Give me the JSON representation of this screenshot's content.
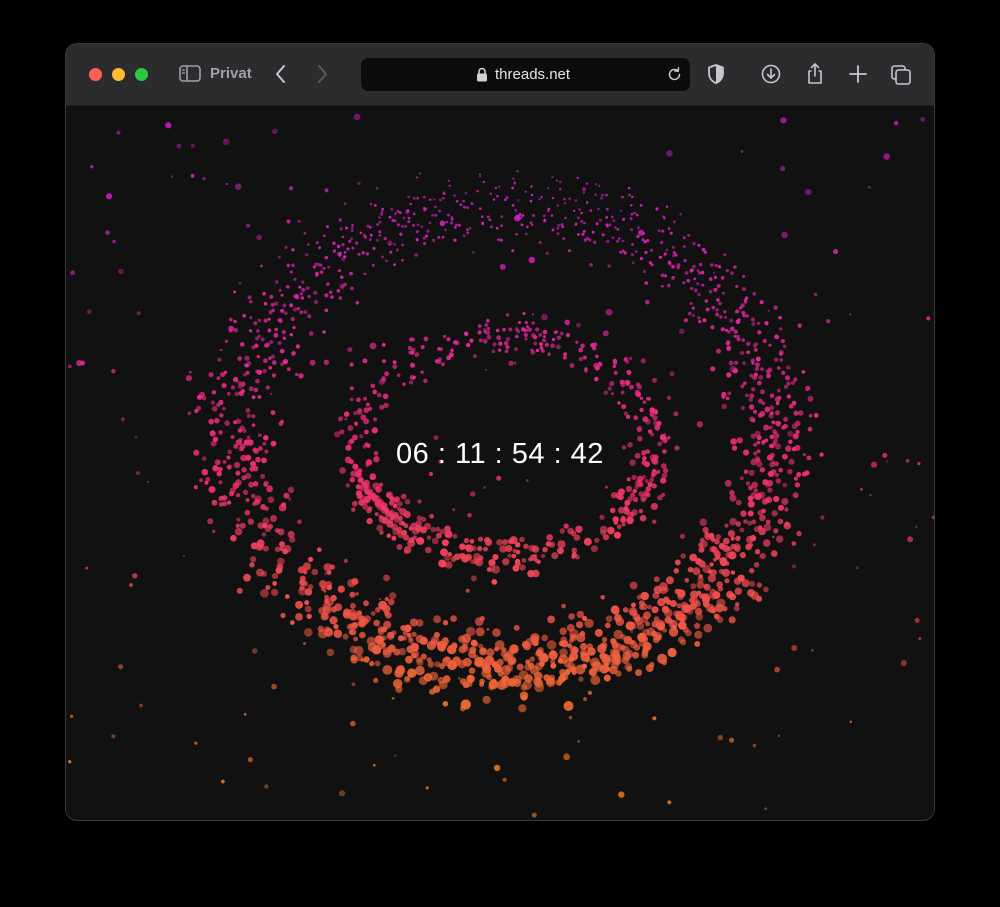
{
  "browser": {
    "profile_label": "Privat",
    "url": "threads.net",
    "icons": {
      "sidebar": "sidebar-icon",
      "back": "chevron-left-icon",
      "forward": "chevron-right-icon",
      "lock": "lock-icon",
      "reload": "reload-icon",
      "privacy": "shield-icon",
      "downloads": "download-icon",
      "share": "share-icon",
      "new_tab": "plus-icon",
      "tab_overview": "tabs-icon"
    }
  },
  "page": {
    "countdown": "06 : 11 : 54 : 42",
    "colors": {
      "background": "#111111",
      "particle_top": "#d91ed0",
      "particle_middle": "#f0306e",
      "particle_bottom": "#f07a22"
    }
  }
}
